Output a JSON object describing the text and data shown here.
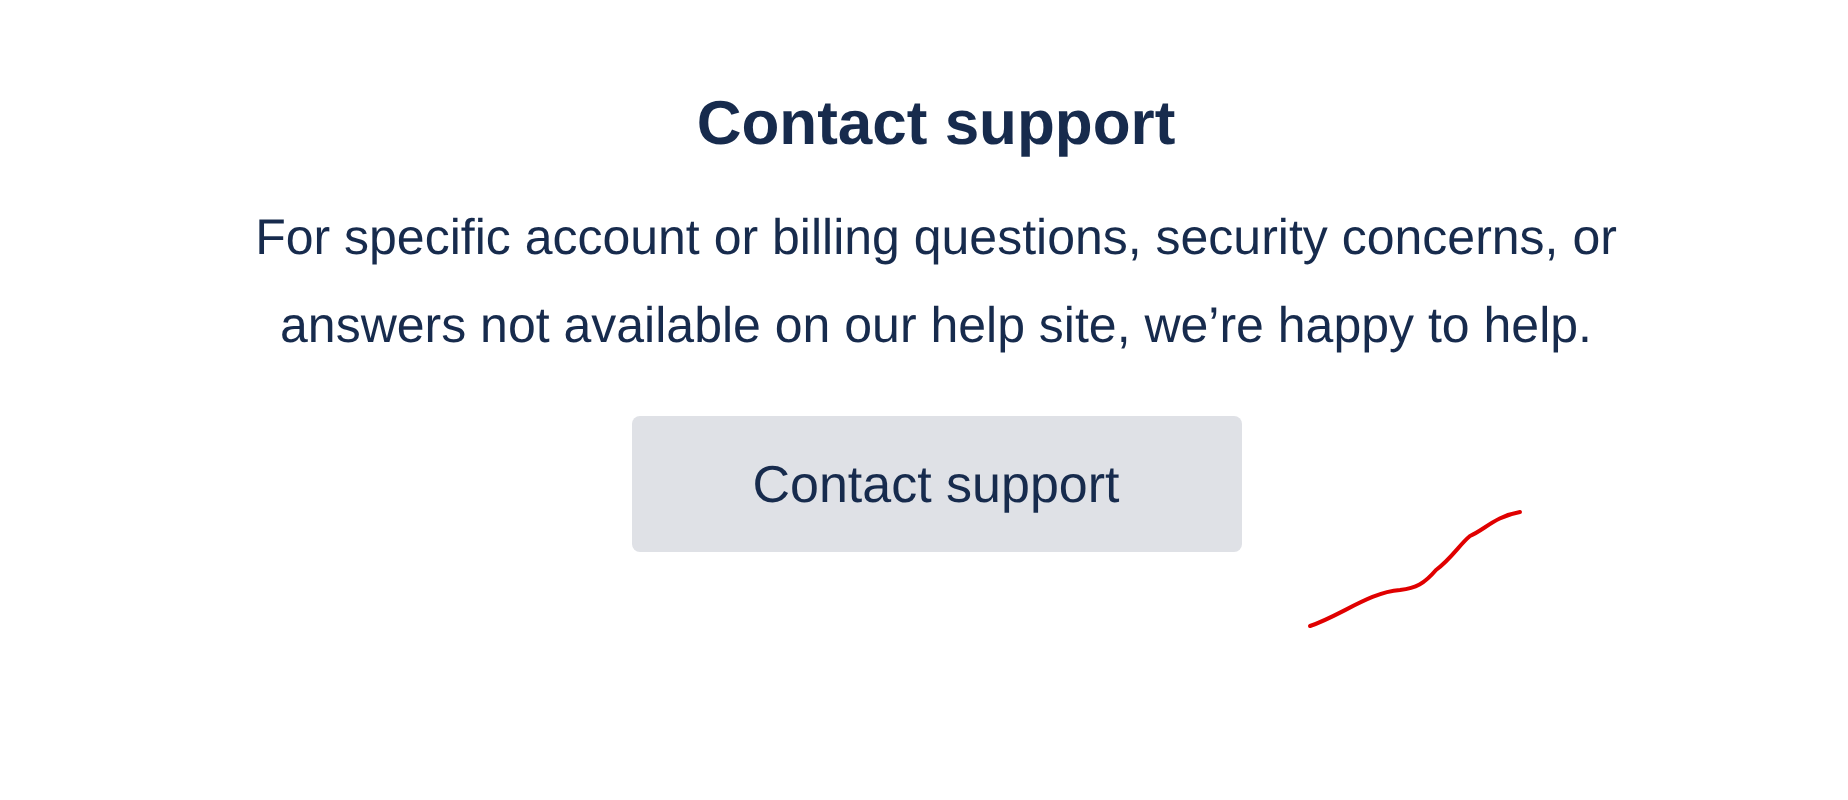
{
  "heading": "Contact support",
  "description": "For specific account or billing questions, security concerns, or answers not available on our help site, we’re happy to help.",
  "button": {
    "label": "Contact support"
  }
}
